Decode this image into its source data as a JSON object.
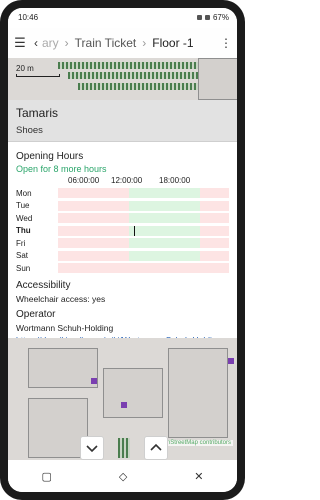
{
  "status_bar": {
    "time": "10:46",
    "battery": "67%"
  },
  "app_bar": {
    "menu_icon": "hamburger-icon",
    "back_icon": "chevron-left-icon",
    "crumbs": [
      "ary",
      "Train Ticket",
      "Floor -1"
    ],
    "overflow_icon": "kebab-icon"
  },
  "map": {
    "scale_label": "20 m",
    "attribution": "enStreetMap contributors"
  },
  "place": {
    "name": "Tamaris",
    "category": "Shoes"
  },
  "opening_hours": {
    "title": "Opening Hours",
    "status": "Open for 8 more hours",
    "time_labels": [
      "06:00:00",
      "12:00:00",
      "18:00:00"
    ],
    "days": [
      {
        "label": "Mon",
        "today": false,
        "open_from": 0.4167,
        "open_to": 0.8333
      },
      {
        "label": "Tue",
        "today": false,
        "open_from": 0.4167,
        "open_to": 0.8333
      },
      {
        "label": "Wed",
        "today": false,
        "open_from": 0.4167,
        "open_to": 0.8333
      },
      {
        "label": "Thu",
        "today": true,
        "open_from": 0.4167,
        "open_to": 0.8333,
        "now": 0.4444
      },
      {
        "label": "Fri",
        "today": false,
        "open_from": 0.4167,
        "open_to": 0.8333
      },
      {
        "label": "Sat",
        "today": false,
        "open_from": 0.4167,
        "open_to": 0.8333
      },
      {
        "label": "Sun",
        "today": false,
        "open_from": 0,
        "open_to": 0
      }
    ]
  },
  "accessibility": {
    "title": "Accessibility",
    "wheelchair": "Wheelchair access: yes"
  },
  "operator": {
    "title": "Operator",
    "name": "Wortmann Schuh-Holding",
    "url": "https://de.wikipedia.org/wiki/Wortmann_Schuh-Holding"
  },
  "controls": {
    "down_icon": "chevron-down-icon",
    "up_icon": "chevron-up-icon"
  },
  "nav_bar": {
    "recents_icon": "square-icon",
    "home_icon": "home-icon",
    "back_icon": "close-icon"
  }
}
